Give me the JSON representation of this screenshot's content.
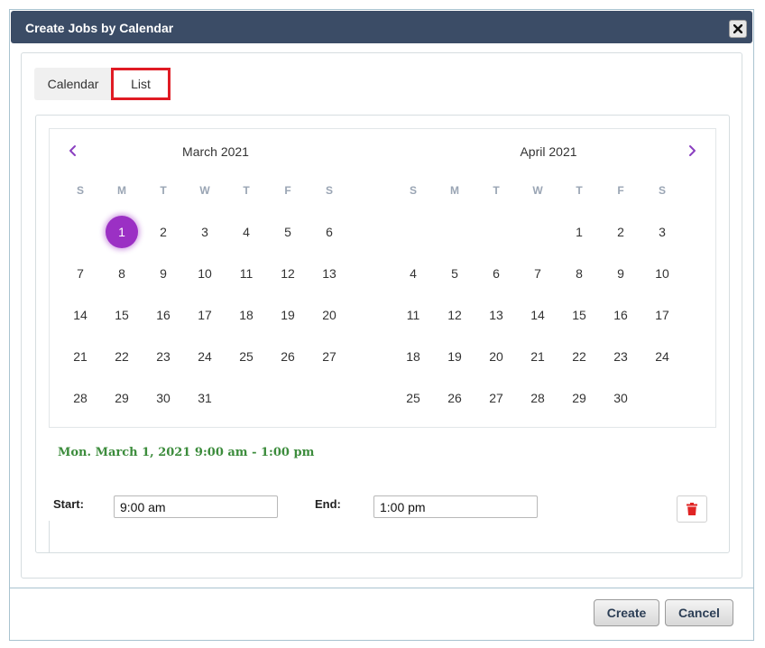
{
  "dialog": {
    "title": "Create Jobs by Calendar",
    "close_icon": "close-icon"
  },
  "tabs": [
    {
      "label": "Calendar",
      "active": true
    },
    {
      "label": "List",
      "highlighted": true
    }
  ],
  "calendar": {
    "selected_color": "#9b30c4",
    "weekday_headers": [
      "S",
      "M",
      "T",
      "W",
      "T",
      "F",
      "S"
    ],
    "months": [
      {
        "title": "March 2021",
        "weeks": [
          [
            "",
            "1",
            "2",
            "3",
            "4",
            "5",
            "6"
          ],
          [
            "7",
            "8",
            "9",
            "10",
            "11",
            "12",
            "13"
          ],
          [
            "14",
            "15",
            "16",
            "17",
            "18",
            "19",
            "20"
          ],
          [
            "21",
            "22",
            "23",
            "24",
            "25",
            "26",
            "27"
          ],
          [
            "28",
            "29",
            "30",
            "31",
            "",
            "",
            ""
          ]
        ],
        "selected_day": "1"
      },
      {
        "title": "April 2021",
        "weeks": [
          [
            "",
            "",
            "",
            "",
            "1",
            "2",
            "3"
          ],
          [
            "4",
            "5",
            "6",
            "7",
            "8",
            "9",
            "10"
          ],
          [
            "11",
            "12",
            "13",
            "14",
            "15",
            "16",
            "17"
          ],
          [
            "18",
            "19",
            "20",
            "21",
            "22",
            "23",
            "24"
          ],
          [
            "25",
            "26",
            "27",
            "28",
            "29",
            "30",
            ""
          ]
        ],
        "selected_day": ""
      }
    ],
    "prev_icon": "chevron-left-icon",
    "next_icon": "chevron-right-icon"
  },
  "selection": {
    "summary": "Mon. March 1, 2021 9:00 am - 1:00 pm",
    "summary_color": "#3c8c3c",
    "start_label": "Start:",
    "start_value": "9:00 am",
    "end_label": "End:",
    "end_value": "1:00 pm",
    "delete_icon": "trash-icon",
    "delete_color": "#e02424"
  },
  "footer": {
    "create_label": "Create",
    "cancel_label": "Cancel"
  }
}
